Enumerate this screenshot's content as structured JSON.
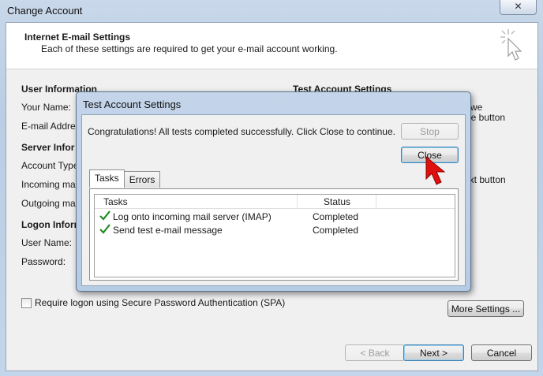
{
  "window": {
    "title": "Change Account",
    "close_glyph": "✕"
  },
  "header": {
    "title": "Internet E-mail Settings",
    "description": "Each of these settings are required to get your e-mail account working."
  },
  "sections": {
    "user_information": "User Information",
    "test_account_settings": "Test Account Settings",
    "server_information": "Server Infor",
    "logon_information": "Logon Inforr"
  },
  "fields": {
    "your_name": "Your Name:",
    "email_address": "E-mail Address",
    "account_type": "Account Type:",
    "incoming_mail": "Incoming mail s",
    "outgoing_mail": "Outgoing mail s",
    "user_name": "User Name:",
    "password": "Password:"
  },
  "right_fragments": {
    "we": "we",
    "the_button": "he button",
    "next_button": "ext button"
  },
  "spa_label": "Require logon using Secure Password Authentication (SPA)",
  "buttons": {
    "more_settings": "More Settings ...",
    "back": "< Back",
    "next": "Next >",
    "cancel": "Cancel"
  },
  "dialog": {
    "title": "Test Account Settings",
    "message": "Congratulations! All tests completed successfully. Click Close to continue.",
    "stop": "Stop",
    "close": "Close",
    "tabs": [
      "Tasks",
      "Errors"
    ],
    "columns": {
      "tasks": "Tasks",
      "status": "Status"
    },
    "rows": [
      {
        "task": "Log onto incoming mail server (IMAP)",
        "status": "Completed"
      },
      {
        "task": "Send test e-mail message",
        "status": "Completed"
      }
    ]
  },
  "colors": {
    "check": "#1e8a1e",
    "cursor": "#e01010"
  }
}
